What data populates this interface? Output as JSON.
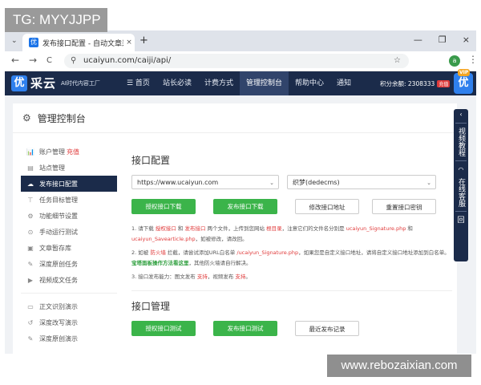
{
  "watermarks": {
    "top_left": "TG: MYYJJPP",
    "bottom_right": "www.rebozaixian.com"
  },
  "browser": {
    "tab_title": "发布接口配置 - 自动文章采集蜀",
    "tab_close": "×",
    "new_tab": "+",
    "url": "ucaiyun.com/caiji/api/",
    "window_controls": [
      "—",
      "❐",
      "×"
    ],
    "nav": {
      "back": "←",
      "forward": "→",
      "reload": "C"
    },
    "extension_letter": "a"
  },
  "site": {
    "logo_badge": "优",
    "brand": "采云",
    "slogan": "AI时代内容工厂",
    "nav": [
      {
        "label": "☰ 首页"
      },
      {
        "label": "站长必读"
      },
      {
        "label": "计费方式"
      },
      {
        "label": "管理控制台",
        "active": true
      },
      {
        "label": "帮助中心"
      },
      {
        "label": "通知"
      }
    ],
    "credit": "积分余额: 2308333",
    "recharge": "充值",
    "vip_badge": "VIP",
    "vip_icon": "优"
  },
  "panel": {
    "title": "管理控制台"
  },
  "sidebar": {
    "items": [
      {
        "icon": "📊",
        "label": "账户管理",
        "extra": "充值"
      },
      {
        "icon": "▤",
        "label": "站点管理"
      },
      {
        "icon": "☁",
        "label": "发布接口配置",
        "active": true
      },
      {
        "icon": "⊤",
        "label": "任务目标管理"
      },
      {
        "icon": "⚙",
        "label": "功能细节设置"
      },
      {
        "icon": "⊙",
        "label": "手动运行测试"
      },
      {
        "icon": "▣",
        "label": "文章暂存库"
      },
      {
        "icon": "✎",
        "label": "深度原创任务"
      },
      {
        "icon": "▶",
        "label": "视频成文任务"
      }
    ],
    "items2": [
      {
        "icon": "▭",
        "label": "正文识别演示"
      },
      {
        "icon": "↺",
        "label": "深度改写演示"
      },
      {
        "icon": "✎",
        "label": "深度原创演示"
      }
    ]
  },
  "api_config": {
    "title": "接口配置",
    "domain_select": "https://www.ucaiyun.com",
    "cms_select": "织梦(dedecms)",
    "buttons": [
      "授权接口下载",
      "发布接口下载",
      "修改接口地址",
      "重置接口密钥"
    ],
    "note1": {
      "a": "1. 请下载 ",
      "b": "授权接口",
      "c": " 和 ",
      "d": "发布接口",
      "e": " 两个文件，上传到您网站 ",
      "f": "根目录",
      "g": "，注意它们的文件名分别是 ",
      "h": "ucaiyun_Signature.php",
      "i": " 和 ",
      "j": "ucaiyun_Savearticle.php",
      "k": "，如被修改，请改回。"
    },
    "note2": {
      "a": "2. 如被 ",
      "b": "防火墙",
      "c": " 拦截，请尝试添加URL白名单 ",
      "d": "/ucaiyun_Signature.php",
      "e": "，如果您是自定义接口地址，请将自定义接口地址添加到白名单。",
      "f": "宝塔面板操作方法看这里",
      "g": "，其他防火墙请自行解决。"
    },
    "note3": {
      "a": "3. 接口发布能力：图文发布 ",
      "b": "支持",
      "c": "，视频发布 ",
      "d": "支持",
      "e": "。"
    }
  },
  "api_manage": {
    "title": "接口管理",
    "buttons": [
      "授权接口测试",
      "发布接口测试",
      "最近发布记录"
    ]
  },
  "right_rail": {
    "arrow": "‹",
    "text1": "视频教程",
    "text2": "在线客服",
    "text3": "回"
  }
}
